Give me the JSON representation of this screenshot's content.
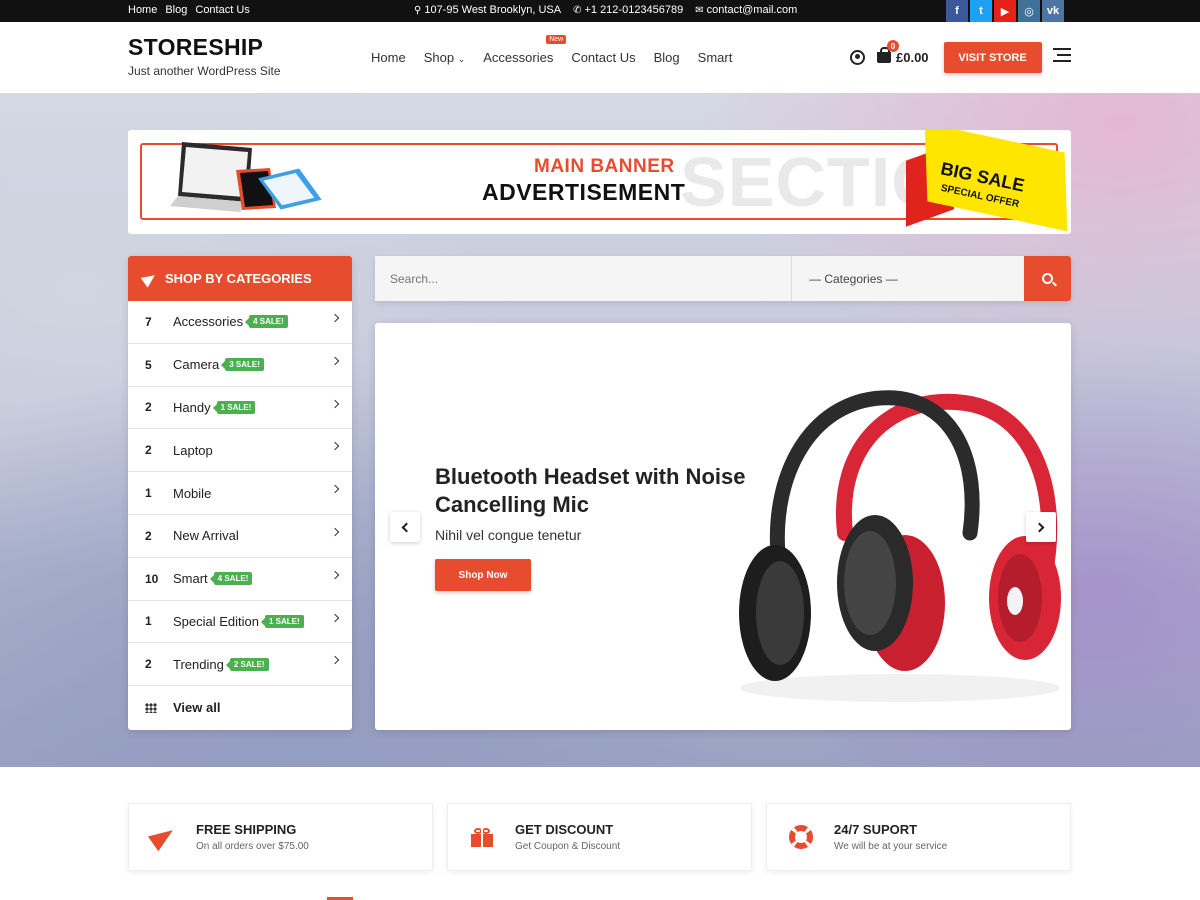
{
  "topbar": {
    "links": [
      "Home",
      "Blog",
      "Contact Us"
    ],
    "address": "107-95 West Brooklyn, USA",
    "phone": "+1 212-0123456789",
    "email": "contact@mail.com",
    "social": [
      {
        "name": "facebook",
        "glyph": "f",
        "color": "#3b5998"
      },
      {
        "name": "twitter",
        "glyph": "t",
        "color": "#1da1f2"
      },
      {
        "name": "youtube",
        "glyph": "▶",
        "color": "#e62117"
      },
      {
        "name": "instagram",
        "glyph": "◎",
        "color": "#3f729b"
      },
      {
        "name": "vk",
        "glyph": "vk",
        "color": "#4c75a3"
      }
    ]
  },
  "header": {
    "brand": "STORESHIP",
    "tagline": "Just another WordPress Site",
    "nav": [
      "Home",
      "Shop",
      "Accessories",
      "Contact Us",
      "Blog",
      "Smart"
    ],
    "new_badge": "New",
    "cart_count": "0",
    "cart_total": "£0.00",
    "visit_store": "VISIT STORE"
  },
  "ad_banner": {
    "line1": "MAIN BANNER",
    "line2": "ADVERTISEMENT",
    "watermark": "SECTION",
    "sale_title": "BIG SALE",
    "sale_sub": "SPECIAL OFFER"
  },
  "categories": {
    "title": "SHOP BY CATEGORIES",
    "items": [
      {
        "count": "7",
        "label": "Accessories",
        "sale": "4 SALE!"
      },
      {
        "count": "5",
        "label": "Camera",
        "sale": "3 SALE!"
      },
      {
        "count": "2",
        "label": "Handy",
        "sale": "1 SALE!"
      },
      {
        "count": "2",
        "label": "Laptop",
        "sale": ""
      },
      {
        "count": "1",
        "label": "Mobile",
        "sale": ""
      },
      {
        "count": "2",
        "label": "New Arrival",
        "sale": ""
      },
      {
        "count": "10",
        "label": "Smart",
        "sale": "4 SALE!"
      },
      {
        "count": "1",
        "label": "Special Edition",
        "sale": "1 SALE!"
      },
      {
        "count": "2",
        "label": "Trending",
        "sale": "2 SALE!"
      }
    ],
    "view_all": "View all"
  },
  "search": {
    "placeholder": "Search...",
    "category_select": "— Categories —"
  },
  "slider": {
    "title": "Bluetooth Headset with Noise Cancelling Mic",
    "subtitle": "Nihil vel congue tenetur",
    "button": "Shop Now"
  },
  "features": [
    {
      "title": "FREE SHIPPING",
      "sub": "On all orders over $75.00",
      "icon": "paper-plane-icon"
    },
    {
      "title": "GET DISCOUNT",
      "sub": "Get Coupon & Discount",
      "icon": "gift-icon"
    },
    {
      "title": "24/7 SUPORT",
      "sub": "We will be at your service",
      "icon": "lifebuoy-icon"
    }
  ],
  "colors": {
    "accent": "#e84c2e",
    "sale_badge": "#4caf50",
    "topbar": "#111111"
  }
}
